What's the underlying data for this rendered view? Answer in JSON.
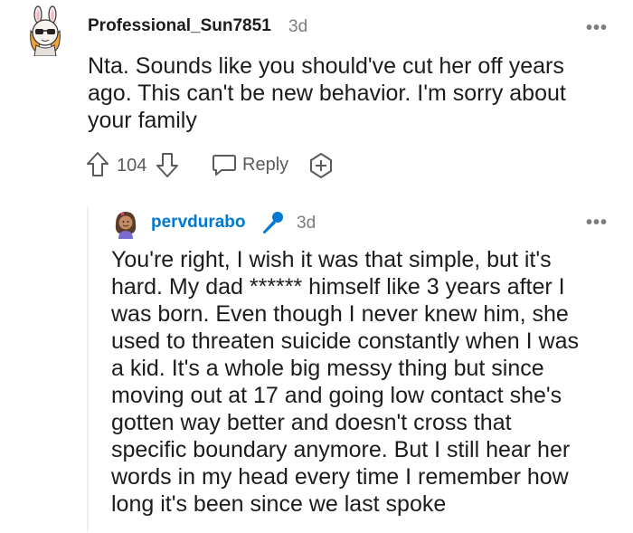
{
  "comments": [
    {
      "username": "Professional_Sun7851",
      "time": "3d",
      "more": "•••",
      "body": [
        "Nta. Sounds like you should've cut her off years",
        "ago. This can't be new behavior. I'm sorry about",
        "your family"
      ],
      "votes": "104",
      "reply_label": "Reply"
    },
    {
      "username": "pervdurabo",
      "time": "3d",
      "more": "•••",
      "body": [
        "You're right, I wish it was that simple, but it's",
        "hard. My dad ****** himself like 3 years after I",
        "was born. Even though I never knew him, she",
        "used to threaten suicide constantly when I was",
        "a kid. It's a whole big messy thing but since",
        "moving out at 17 and going low contact she's",
        "gotten way better and doesn't cross that",
        "specific boundary anymore. But I still hear her",
        "words in my head every time I remember how",
        "long it's been since we last spoke"
      ]
    }
  ],
  "colors": {
    "username_highlight": "#0079d3",
    "meta_gray": "#7c7c7c",
    "thread_line": "#edeff1"
  },
  "icons": [
    "avatar",
    "upvote-icon",
    "downvote-icon",
    "reply-icon",
    "award-icon",
    "microphone-flair-icon"
  ]
}
